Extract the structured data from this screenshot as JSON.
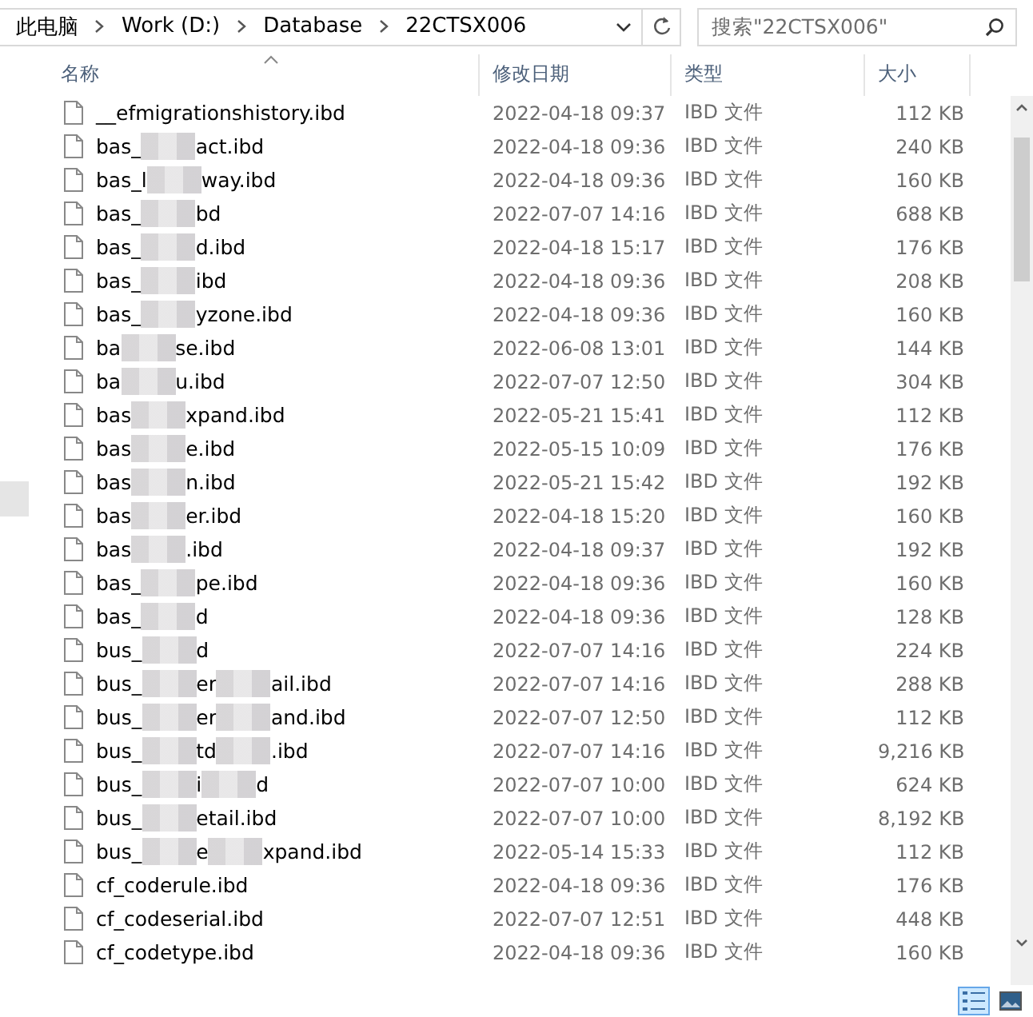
{
  "breadcrumb": [
    "此电脑",
    "Work (D:)",
    "Database",
    "22CTSX006"
  ],
  "search": {
    "placeholder": "搜索\"22CTSX006\""
  },
  "columns": [
    {
      "label": "名称",
      "sorted": true
    },
    {
      "label": "修改日期",
      "sorted": false
    },
    {
      "label": "类型",
      "sorted": false
    },
    {
      "label": "大小",
      "sorted": false
    }
  ],
  "files": [
    {
      "name_parts": [
        "__efmigrationshistory.ibd"
      ],
      "modified": "2022-04-18 09:37",
      "type": "IBD 文件",
      "size": "112 KB"
    },
    {
      "name_parts": [
        "bas_",
        "act.ibd"
      ],
      "modified": "2022-04-18 09:36",
      "type": "IBD 文件",
      "size": "240 KB"
    },
    {
      "name_parts": [
        "bas_l",
        "way.ibd"
      ],
      "modified": "2022-04-18 09:36",
      "type": "IBD 文件",
      "size": "160 KB"
    },
    {
      "name_parts": [
        "bas_",
        "bd"
      ],
      "modified": "2022-07-07 14:16",
      "type": "IBD 文件",
      "size": "688 KB"
    },
    {
      "name_parts": [
        "bas_",
        "d.ibd"
      ],
      "modified": "2022-04-18 15:17",
      "type": "IBD 文件",
      "size": "176 KB"
    },
    {
      "name_parts": [
        "bas_",
        "ibd"
      ],
      "modified": "2022-04-18 09:36",
      "type": "IBD 文件",
      "size": "208 KB"
    },
    {
      "name_parts": [
        "bas_",
        "yzone.ibd"
      ],
      "modified": "2022-04-18 09:36",
      "type": "IBD 文件",
      "size": "160 KB"
    },
    {
      "name_parts": [
        "ba",
        "se.ibd"
      ],
      "modified": "2022-06-08 13:01",
      "type": "IBD 文件",
      "size": "144 KB"
    },
    {
      "name_parts": [
        "ba",
        "u.ibd"
      ],
      "modified": "2022-07-07 12:50",
      "type": "IBD 文件",
      "size": "304 KB"
    },
    {
      "name_parts": [
        "bas",
        "xpand.ibd"
      ],
      "modified": "2022-05-21 15:41",
      "type": "IBD 文件",
      "size": "112 KB"
    },
    {
      "name_parts": [
        "bas",
        "e.ibd"
      ],
      "modified": "2022-05-15 10:09",
      "type": "IBD 文件",
      "size": "176 KB"
    },
    {
      "name_parts": [
        "bas",
        "n.ibd"
      ],
      "modified": "2022-05-21 15:42",
      "type": "IBD 文件",
      "size": "192 KB"
    },
    {
      "name_parts": [
        "bas",
        "er.ibd"
      ],
      "modified": "2022-04-18 15:20",
      "type": "IBD 文件",
      "size": "160 KB"
    },
    {
      "name_parts": [
        "bas",
        ".ibd"
      ],
      "modified": "2022-04-18 09:37",
      "type": "IBD 文件",
      "size": "192 KB"
    },
    {
      "name_parts": [
        "bas_",
        "pe.ibd"
      ],
      "modified": "2022-04-18 09:36",
      "type": "IBD 文件",
      "size": "160 KB"
    },
    {
      "name_parts": [
        "bas_",
        "d"
      ],
      "modified": "2022-04-18 09:36",
      "type": "IBD 文件",
      "size": "128 KB"
    },
    {
      "name_parts": [
        "bus_",
        "d"
      ],
      "modified": "2022-07-07 14:16",
      "type": "IBD 文件",
      "size": "224 KB"
    },
    {
      "name_parts": [
        "bus_",
        "er",
        "ail.ibd"
      ],
      "modified": "2022-07-07 14:16",
      "type": "IBD 文件",
      "size": "288 KB"
    },
    {
      "name_parts": [
        "bus_",
        "er",
        "and.ibd"
      ],
      "modified": "2022-07-07 12:50",
      "type": "IBD 文件",
      "size": "112 KB"
    },
    {
      "name_parts": [
        "bus_",
        "td",
        ".ibd"
      ],
      "modified": "2022-07-07 14:16",
      "type": "IBD 文件",
      "size": "9,216 KB"
    },
    {
      "name_parts": [
        "bus_",
        "i",
        "d"
      ],
      "modified": "2022-07-07 10:00",
      "type": "IBD 文件",
      "size": "624 KB"
    },
    {
      "name_parts": [
        "bus_",
        "etail.ibd"
      ],
      "modified": "2022-07-07 10:00",
      "type": "IBD 文件",
      "size": "8,192 KB"
    },
    {
      "name_parts": [
        "bus_",
        "e",
        "xpand.ibd"
      ],
      "modified": "2022-05-14 15:33",
      "type": "IBD 文件",
      "size": "112 KB"
    },
    {
      "name_parts": [
        "cf_coderule.ibd"
      ],
      "modified": "2022-04-18 09:36",
      "type": "IBD 文件",
      "size": "176 KB"
    },
    {
      "name_parts": [
        "cf_codeserial.ibd"
      ],
      "modified": "2022-07-07 12:51",
      "type": "IBD 文件",
      "size": "448 KB"
    },
    {
      "name_parts": [
        "cf_codetype.ibd"
      ],
      "modified": "2022-04-18 09:36",
      "type": "IBD 文件",
      "size": "160 KB"
    }
  ],
  "view_modes": [
    {
      "kind": "details",
      "selected": true
    },
    {
      "kind": "large-icons",
      "selected": false
    }
  ]
}
